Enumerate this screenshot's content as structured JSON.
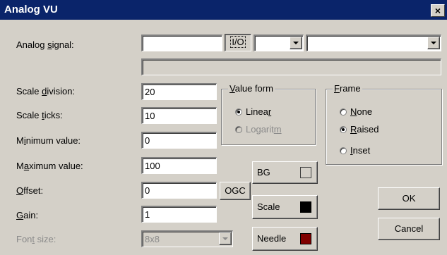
{
  "window": {
    "title": "Analog VU",
    "close": "×"
  },
  "labels": {
    "analog_signal": "Analog signal:",
    "scale_division": "Scale division:",
    "scale_ticks": "Scale ticks:",
    "minimum_value": "Minimum value:",
    "maximum_value": "Maximum value:",
    "offset": "Offset",
    "gain": "Gain:",
    "font_size": "Font size:"
  },
  "fields": {
    "analog_signal": "",
    "scale_division": "20",
    "scale_ticks": "10",
    "minimum_value": "0",
    "maximum_value": "100",
    "offset": "0",
    "gain": "1",
    "font_size": "8x8"
  },
  "buttons": {
    "io": "I/O",
    "ogc": "OGC",
    "bg": "BG",
    "scale": "Scale",
    "needle": "Needle",
    "ok": "OK",
    "cancel": "Cancel"
  },
  "value_form": {
    "title": "Value form",
    "linear": "Linear",
    "logaritm": "Logaritm",
    "selected": "Linear"
  },
  "frame": {
    "title": "Frame",
    "none": "None",
    "raised": "Raised",
    "inset": "Inset",
    "selected": "Raised"
  },
  "colors": {
    "titlebar": "#0a246a",
    "bg_swatch": "#d4d0c8",
    "scale_swatch": "#000000",
    "needle_swatch": "#800000"
  }
}
